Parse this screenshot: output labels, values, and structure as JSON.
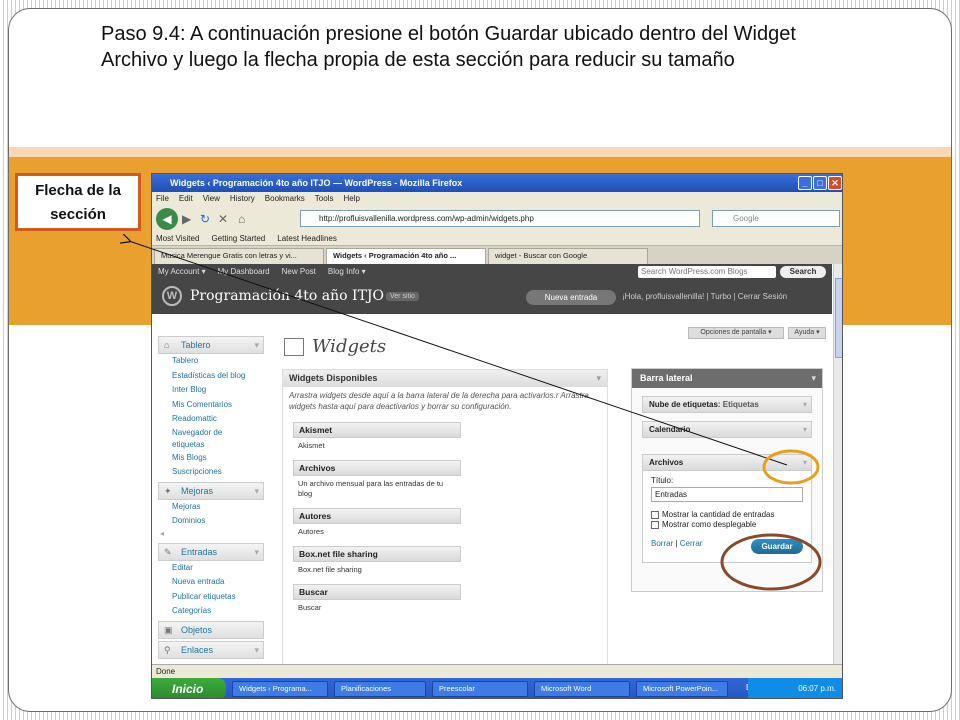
{
  "slide": {
    "title": "Paso 9.4: A continuación presione el botón Guardar ubicado  dentro del Widget Archivo y luego la flecha propia de esta sección para reducir su tamaño",
    "callout": "Flecha de la sección",
    "colors": {
      "orange_band": "#e9a02f",
      "callout_border": "#d05a20",
      "circle_orange": "#e6a020",
      "circle_brown": "#8a4a2a"
    }
  },
  "browser": {
    "window_title": "Widgets ‹ Programación 4to año ITJO — WordPress - Mozilla Firefox",
    "menu": [
      "File",
      "Edit",
      "View",
      "History",
      "Bookmarks",
      "Tools",
      "Help"
    ],
    "url": "http://profluisvallenilla.wordpress.com/wp-admin/widgets.php",
    "search_placeholder": "Google",
    "bookmarks": [
      "Most Visited",
      "Getting Started",
      "Latest Headlines"
    ],
    "tabs": [
      {
        "label": "Musica Merengue Gratis con letras y vi...",
        "active": false
      },
      {
        "label": "Widgets ‹ Programación 4to año ...",
        "active": true
      },
      {
        "label": "widget - Buscar con Google",
        "active": false
      }
    ],
    "status": "Done"
  },
  "wp": {
    "adminbar": [
      "My Account ▾",
      "My Dashboard",
      "New Post",
      "Blog Info ▾"
    ],
    "search_placeholder": "Search WordPress.com Blogs",
    "search_button": "Search",
    "blog_title": "Programación 4to año ITJO",
    "view_site": "Ver sitio",
    "new_entry": "Nueva entrada",
    "greeting": "¡Hola, profluisvallenilla! | Turbo | Cerrar Sesión",
    "screen_options": "Opciones de pantalla ▾",
    "help": "Ayuda ▾",
    "page_heading": "Widgets",
    "menu": {
      "tablero": "Tablero",
      "tablero_items": [
        "Tablero",
        "Estadísticas del blog",
        "Inter Blog",
        "Mis Comentarios",
        "Readomattic",
        "Navegador de etiquetas",
        "Mis Blogs",
        "Suscripciones"
      ],
      "mejoras": "Mejoras",
      "mejoras_items": [
        "Mejoras",
        "Dominios"
      ],
      "entradas": "Entradas",
      "entradas_items": [
        "Editar",
        "Nueva entrada",
        "Publicar etiquetas",
        "Categorías"
      ],
      "objetos": "Objetos",
      "enlaces": "Enlaces"
    },
    "available": {
      "header": "Widgets Disponibles",
      "description": "Arrastra widgets desde aquí a la barra lateral de la derecha para activarlos.r Arrastra widgets hasta aquí para deactivarlos y borrar su configuración.",
      "widgets": [
        {
          "name": "Akismet",
          "desc": "Akismet"
        },
        {
          "name": "Archivos",
          "desc": "Un archivo mensual para las entradas de tu blog"
        },
        {
          "name": "Autores",
          "desc": "Autores"
        },
        {
          "name": "Box.net file sharing",
          "desc": "Box.net file sharing"
        },
        {
          "name": "Buscar",
          "desc": "Buscar"
        }
      ]
    },
    "sidebar_panel": {
      "header": "Barra lateral",
      "tag_cloud": "Nube de etiquetas",
      "tag_cloud_sub": ": Etiquetas",
      "calendar": "Calendario",
      "archives": "Archivos",
      "title_label": "Título:",
      "title_value": "Entradas",
      "show_count": "Mostrar la cantidad de entradas",
      "show_dropdown": "Mostrar como desplegable",
      "delete": "Borrar",
      "separator": "|",
      "close": "Cerrar",
      "save": "Guardar"
    }
  },
  "taskbar": {
    "start": "Inicio",
    "items": [
      "Widgets ‹ Programa...",
      "Planificaciones",
      "Preescolar",
      "Microsoft Word",
      "Microsoft PowerPoin..."
    ],
    "lang": "ES",
    "clock": "06:07 p.m."
  }
}
